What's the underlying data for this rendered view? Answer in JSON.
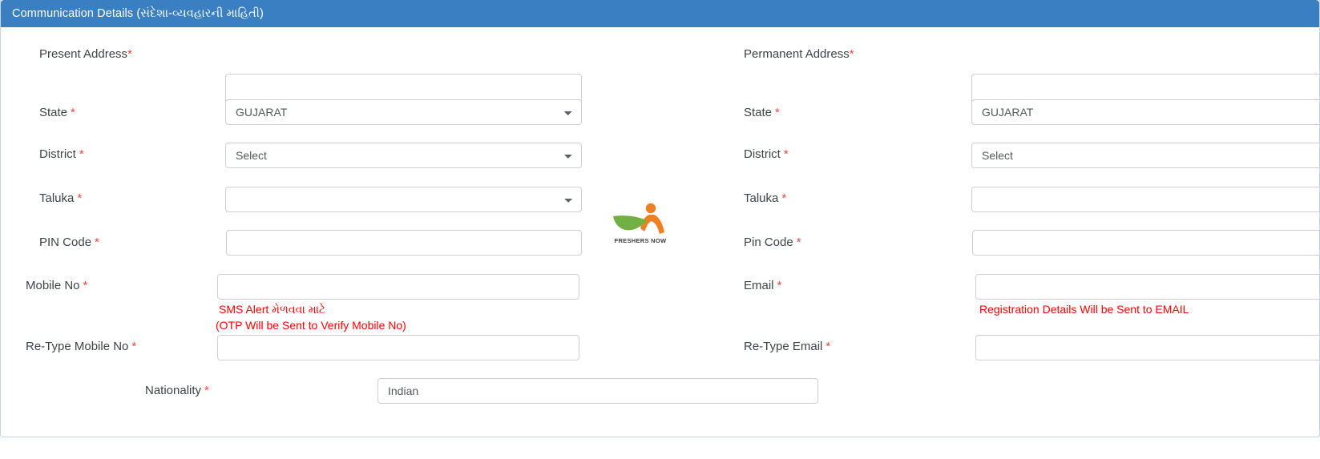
{
  "panel": {
    "title": "Communication Details (સંદેશા-વ્યવહારની માહિતી)",
    "header_color": "#3a7fc1"
  },
  "watermark": {
    "text": "FRESHERS NOW",
    "leaf_color": "#72b043",
    "figure_color": "#ef7f20"
  },
  "left_column": {
    "present_address": {
      "label": "Present Address",
      "required": "*",
      "value": "",
      "placeholder": ""
    },
    "state": {
      "label": "State",
      "required": "*",
      "value": "GUJARAT",
      "options": [
        "GUJARAT"
      ]
    },
    "district": {
      "label": "District",
      "required": "*",
      "value": "Select",
      "options": [
        "Select"
      ]
    },
    "taluka": {
      "label": "Taluka",
      "required": "*",
      "value": "",
      "options": [
        ""
      ]
    },
    "pin_code": {
      "label": "PIN Code",
      "required": "*",
      "value": "",
      "placeholder": ""
    },
    "mobile_no": {
      "label": "Mobile No",
      "required": "*",
      "value": "",
      "placeholder": "",
      "hint_line1": "SMS Alert મેળવવા માટે",
      "hint_line2": "(OTP Will be Sent to Verify Mobile No)",
      "hint_color": "#ff0000"
    },
    "retype_mobile_no": {
      "label": "Re-Type Mobile No",
      "required": "*",
      "value": "",
      "placeholder": ""
    }
  },
  "right_column": {
    "permanent_address": {
      "label": "Permanent Address",
      "required": "*",
      "value": "",
      "placeholder": ""
    },
    "state": {
      "label": "State",
      "required": "*",
      "value": "GUJARAT",
      "options": [
        "GUJARAT"
      ]
    },
    "district": {
      "label": "District",
      "required": "*",
      "value": "Select",
      "options": [
        "Select"
      ]
    },
    "taluka": {
      "label": "Taluka",
      "required": "*",
      "value": "",
      "options": [
        ""
      ]
    },
    "pin_code": {
      "label": "Pin Code",
      "required": "*",
      "value": "",
      "placeholder": ""
    },
    "email": {
      "label": "Email",
      "required": "*",
      "value": "",
      "placeholder": "",
      "hint_line1": "Registration Details Will be Sent to EMAIL",
      "hint_color": "#ff0000"
    },
    "retype_email": {
      "label": "Re-Type Email",
      "required": "*",
      "value": "",
      "placeholder": ""
    }
  },
  "footer_row": {
    "nationality": {
      "label": "Nationality",
      "required": "*",
      "value": "Indian",
      "placeholder": ""
    }
  }
}
